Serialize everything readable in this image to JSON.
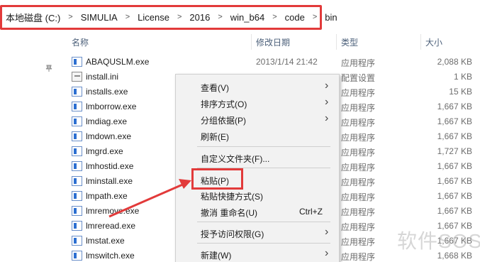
{
  "address_bar": {
    "crumbs": [
      "本地磁盘 (C:)",
      "SIMULIA",
      "License",
      "2016",
      "win_b64",
      "code",
      "bin"
    ]
  },
  "columns": {
    "name": "名称",
    "date": "修改日期",
    "type": "类型",
    "size": "大小"
  },
  "files": [
    {
      "name": "ABAQUSLM.exe",
      "date": "2013/1/14 21:42",
      "type": "应用程序",
      "size": "2,088 KB",
      "icon": "exe-icon"
    },
    {
      "name": "install.ini",
      "date": "",
      "type": "配置设置",
      "size": "1 KB",
      "icon": "ini-file-icon"
    },
    {
      "name": "installs.exe",
      "date": "",
      "type": "应用程序",
      "size": "15 KB",
      "icon": "exe-icon"
    },
    {
      "name": "lmborrow.exe",
      "date": "",
      "type": "应用程序",
      "size": "1,667 KB",
      "icon": "exe-icon"
    },
    {
      "name": "lmdiag.exe",
      "date": "",
      "type": "应用程序",
      "size": "1,667 KB",
      "icon": "exe-icon"
    },
    {
      "name": "lmdown.exe",
      "date": "",
      "type": "应用程序",
      "size": "1,667 KB",
      "icon": "exe-icon"
    },
    {
      "name": "lmgrd.exe",
      "date": "",
      "type": "应用程序",
      "size": "1,727 KB",
      "icon": "exe-icon"
    },
    {
      "name": "lmhostid.exe",
      "date": "",
      "type": "应用程序",
      "size": "1,667 KB",
      "icon": "exe-icon"
    },
    {
      "name": "lminstall.exe",
      "date": "",
      "type": "应用程序",
      "size": "1,667 KB",
      "icon": "exe-icon"
    },
    {
      "name": "lmpath.exe",
      "date": "",
      "type": "应用程序",
      "size": "1,667 KB",
      "icon": "exe-icon"
    },
    {
      "name": "lmremove.exe",
      "date": "",
      "type": "应用程序",
      "size": "1,667 KB",
      "icon": "exe-icon"
    },
    {
      "name": "lmreread.exe",
      "date": "",
      "type": "应用程序",
      "size": "1,667 KB",
      "icon": "exe-icon"
    },
    {
      "name": "lmstat.exe",
      "date": "",
      "type": "应用程序",
      "size": "1,667 KB",
      "icon": "exe-icon"
    },
    {
      "name": "lmswitch.exe",
      "date": "",
      "type": "应用程序",
      "size": "1,668 KB",
      "icon": "exe-icon"
    }
  ],
  "context_menu": {
    "view": "查看(V)",
    "sort": "排序方式(O)",
    "group": "分组依据(P)",
    "refresh": "刷新(E)",
    "customize": "自定义文件夹(F)...",
    "paste": "粘贴(P)",
    "paste_shortcut": "粘贴快捷方式(S)",
    "undo_rename": "撤消 重命名(U)",
    "undo_shortcut": "Ctrl+Z",
    "give_access": "授予访问权限(G)",
    "new": "新建(W)"
  },
  "watermark": "软件SOS",
  "colors": {
    "highlight": "#e23a3a",
    "header_text": "#4c607a",
    "menu_bg": "#f2f2f2"
  }
}
